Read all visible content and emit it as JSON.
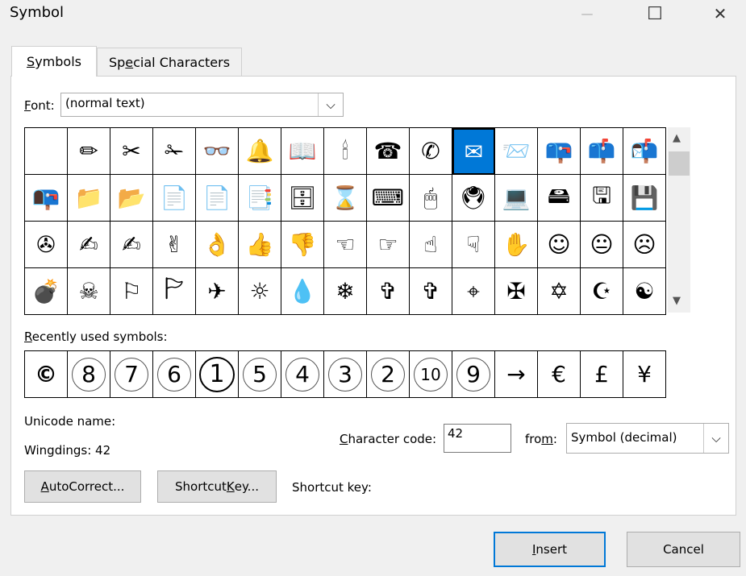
{
  "window": {
    "title": "Symbol",
    "minimize_glyph": "—",
    "maximize_glyph": "☐",
    "close_glyph": "✕"
  },
  "tabs": {
    "symbols": {
      "pre": "",
      "key": "S",
      "post": "ymbols"
    },
    "special": {
      "pre": "Sp",
      "key": "e",
      "post": "cial Characters"
    }
  },
  "font": {
    "label_key": "F",
    "label_rest": "ont:",
    "value": "(normal text)",
    "chevron": "⌵"
  },
  "symbol_grid": {
    "selected_index": 10,
    "rows": [
      [
        "",
        "✏",
        "✂",
        "✁",
        "👓",
        "🔔",
        "📖",
        "🕯",
        "☎",
        "✆",
        "✉",
        "📨",
        "📪",
        "📫",
        "📬"
      ],
      [
        "📭",
        "📁",
        "📂",
        "📄",
        "📄",
        "📑",
        "🗄",
        "⌛",
        "⌨",
        "🖱",
        "🖲",
        "💻",
        "🖴",
        "🖫",
        "💾"
      ],
      [
        "✇",
        "✍",
        "✍",
        "✌",
        "👌",
        "👍",
        "👎",
        "☜",
        "☞",
        "☝",
        "☟",
        "✋",
        "☺",
        "😐",
        "☹"
      ],
      [
        "💣",
        "☠",
        "⚐",
        "🏱",
        "✈",
        "☼",
        "💧",
        "❄",
        "✞",
        "✞",
        "⌖",
        "✠",
        "✡",
        "☪",
        "☯"
      ]
    ],
    "scroll_up": "▲",
    "scroll_down": "▼"
  },
  "recent": {
    "label_key": "R",
    "label_rest": "ecently used symbols:",
    "items": [
      "©",
      "8",
      "7",
      "6",
      "1",
      "5",
      "4",
      "3",
      "2",
      "10",
      "9",
      "→",
      "€",
      "£",
      "¥"
    ],
    "circled": [
      false,
      true,
      true,
      true,
      true,
      true,
      true,
      true,
      true,
      true,
      true,
      false,
      false,
      false,
      false
    ]
  },
  "unicode_name_label": "Unicode name:",
  "char_name": "Wingdings: 42",
  "char_code": {
    "label_key": "C",
    "label_rest": "haracter code:",
    "value": "42"
  },
  "from": {
    "label_pre": "fro",
    "label_key": "m",
    "label_post": ":",
    "value": "Symbol (decimal)",
    "chevron": "⌵"
  },
  "buttons": {
    "autocorrect": {
      "pre": "",
      "key": "A",
      "post": "utoCorrect..."
    },
    "shortcut_key": {
      "pre": "Shortcut ",
      "key": "K",
      "post": "ey..."
    },
    "insert": {
      "pre": "",
      "key": "I",
      "post": "nsert"
    },
    "cancel": "Cancel"
  },
  "shortcut_key_label": "Shortcut key:",
  "colors": {
    "accent": "#0078d7",
    "panel_bg": "#ffffff",
    "dialog_bg": "#f0f0f0"
  }
}
